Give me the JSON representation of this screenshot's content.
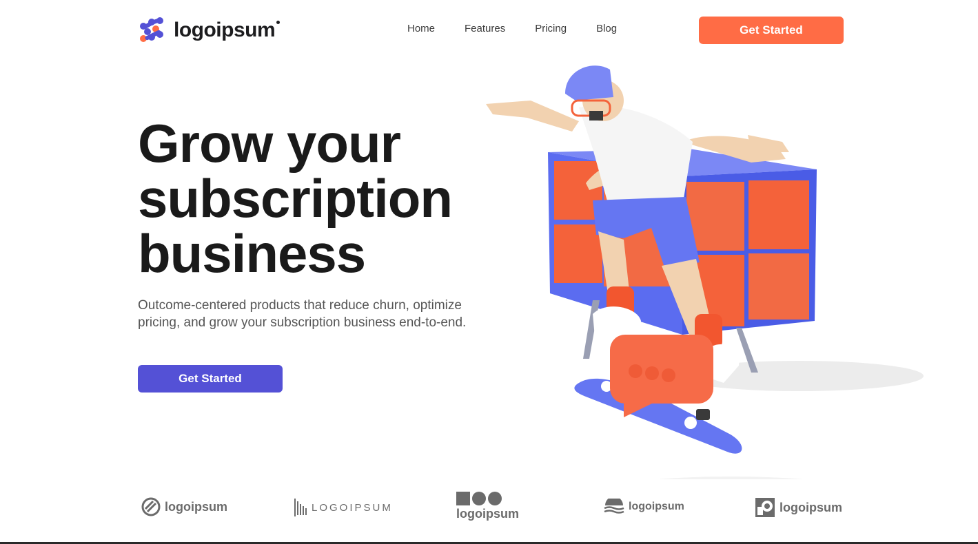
{
  "nav": {
    "brand": "logoipsum",
    "items": [
      {
        "label": "Home"
      },
      {
        "label": "Features"
      },
      {
        "label": "Pricing"
      },
      {
        "label": "Blog"
      }
    ],
    "cta_label": "Get Started"
  },
  "hero": {
    "title_line1": "Grow your",
    "title_line2": "subscription",
    "title_line3": "business",
    "subtitle": "Outcome-centered products that reduce churn, optimize pricing, and grow your subscription business end-to-end.",
    "cta_label": "Get Started"
  },
  "logos": [
    {
      "text": "logoipsum",
      "icon": "circle-stripes-icon"
    },
    {
      "text": "LOGOIPSUM",
      "icon": "barcode-icon"
    },
    {
      "text": "logoipsum",
      "icon": "square-circles-icon"
    },
    {
      "text": "logoipsum",
      "icon": "waves-icon"
    },
    {
      "text": "logoipsum",
      "icon": "square-ring-icon"
    }
  ],
  "colors": {
    "accent_orange": "#ff6c45",
    "accent_purple": "#5451d6",
    "illustration_blue": "#5b6cf0",
    "illustration_orange": "#f4623a"
  }
}
